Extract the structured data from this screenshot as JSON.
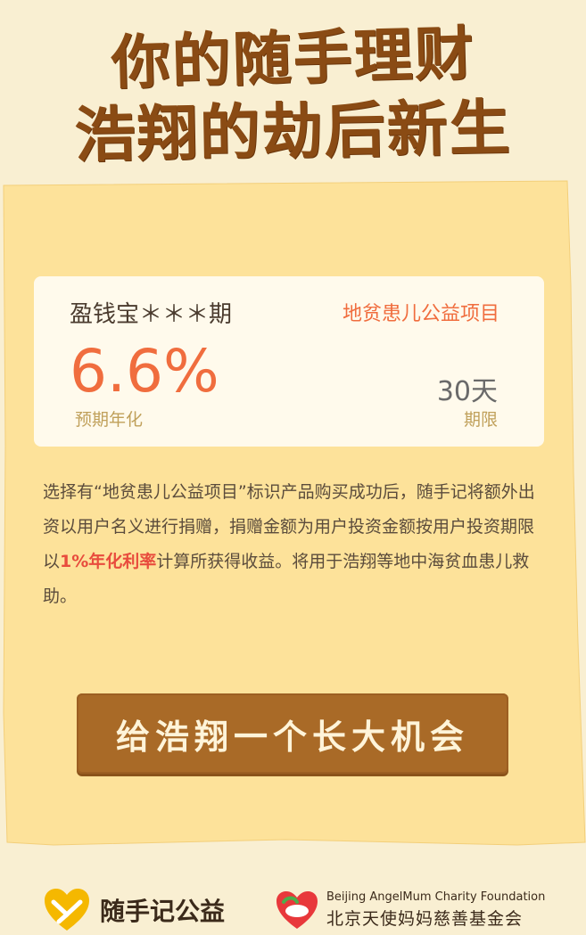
{
  "headline": {
    "line1": "你的随手理财",
    "line2": "浩翔的劫后新生"
  },
  "product": {
    "name": "盈钱宝＊＊＊期",
    "tag": "地贫患儿公益项目",
    "rate": "6.6%",
    "rate_label": "预期年化",
    "term": "30天",
    "term_label": "期限"
  },
  "description": {
    "part1": "选择有“地贫患儿公益项目”标识产品购买成功后，随手记将额外出资以用户名义进行捐赠，捐赠金额为用户投资金额按用户投资期限以",
    "highlight": "1%年化利率",
    "part2": "计算所获得收益。将用于浩翔等地中海贫血患儿救助。"
  },
  "cta": {
    "label": "给浩翔一个长大机会"
  },
  "footer": {
    "brand1": "随手记公益",
    "brand2_en": "Beijing AngelMum Charity Foundation",
    "brand2_cn": "北京天使妈妈慈善基金会"
  },
  "colors": {
    "background": "#f9efd2",
    "paper": "#fde29a",
    "accent": "#f06d3e",
    "brown": "#a96a27",
    "headline": "#8a4b14"
  }
}
